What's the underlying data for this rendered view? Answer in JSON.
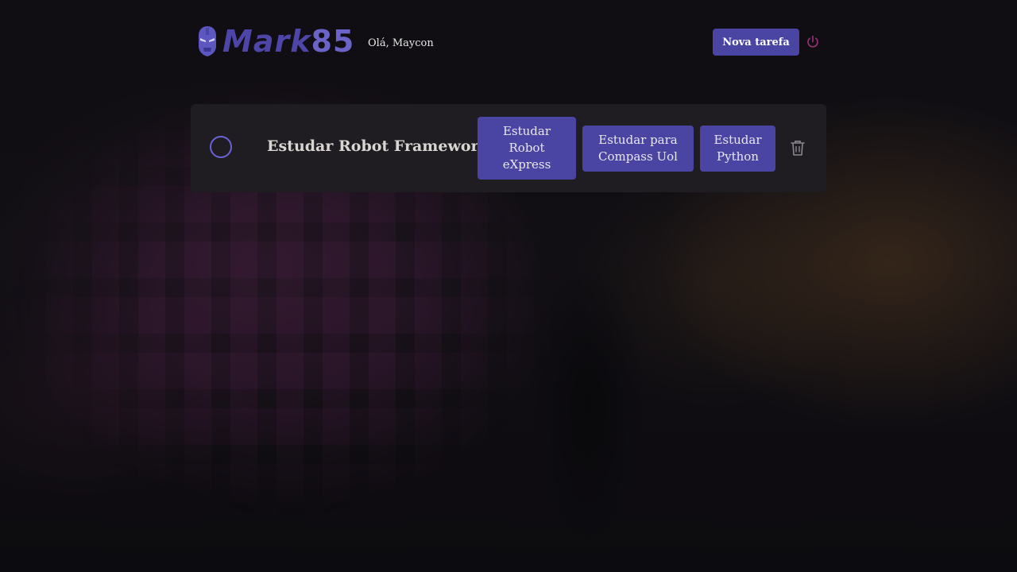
{
  "brand": {
    "logo_text": "Mark",
    "logo_number": "85",
    "icon": "iron-man-helmet-icon",
    "colors": {
      "primary": "#4a45a3",
      "logo": "#4d46a8",
      "accent": "#6a63d8"
    }
  },
  "header": {
    "greeting": "Olá, Maycon",
    "new_task_label": "Nova tarefa",
    "logout_icon": "power-icon"
  },
  "tasks": [
    {
      "title": "Estudar Robot Framework",
      "done": false,
      "tags": [
        "Estudar Robot eXpress",
        "Estudar para Compass Uol",
        "Estudar Python"
      ],
      "delete_icon": "trash-icon"
    }
  ]
}
